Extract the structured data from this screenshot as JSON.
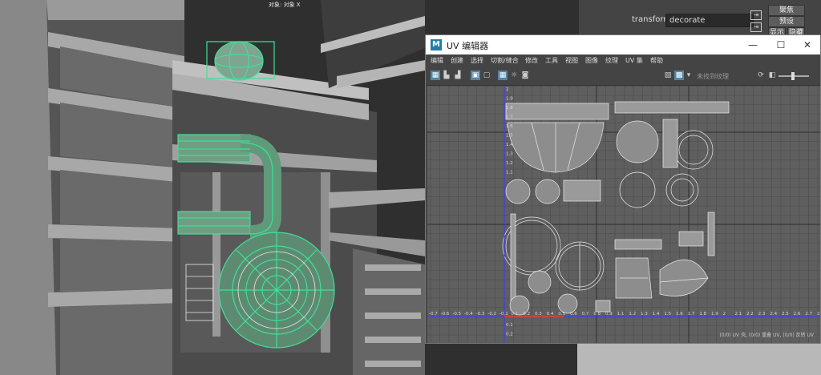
{
  "viewport": {
    "label": "对象: 对象 X"
  },
  "attribute_editor": {
    "transform_label": "transform:",
    "transform_value": "decorate",
    "focus_button": "聚焦",
    "presets_button": "预设",
    "show_button": "显示",
    "hide_button": "隐藏"
  },
  "uv_editor": {
    "logo_letter": "M",
    "title": "UV 编辑器",
    "window_controls": {
      "minimize": "—",
      "maximize": "☐",
      "close": "✕"
    },
    "menu": [
      "编辑",
      "创建",
      "选择",
      "切割/缝合",
      "修改",
      "工具",
      "视图",
      "图像",
      "纹理",
      "UV 集",
      "帮助"
    ],
    "texture_filter": "未找到纹理",
    "status": "(0/0) UV 壳, (0/0) 重叠 UV, (0/0) 反转 UV",
    "axis_ticks": [
      "-0.7",
      "-0.6",
      "-0.5",
      "-0.4",
      "-0.3",
      "-0.2",
      "-0.1",
      "0.1",
      "0.2",
      "0.3",
      "0.4",
      "0.5",
      "0.6",
      "0.7",
      "0.8",
      "0.9",
      "1.1",
      "1.2",
      "1.3",
      "1.4",
      "1.5",
      "1.6",
      "1.7",
      "1.8",
      "1.9",
      "2",
      "2.1",
      "2.2",
      "2.3",
      "2.4",
      "2.5",
      "2.6",
      "2.7",
      "2.8"
    ],
    "y_ticks": [
      "2",
      "1.9",
      "1.8",
      "1.7",
      "1.6",
      "1.5",
      "1.4",
      "1.3",
      "1.2",
      "1.1",
      "0.1",
      "0.2"
    ]
  },
  "colors": {
    "selection_green": "#3fe09a",
    "axis_blue": "#3a3aff",
    "axis_red": "#ff3a3a",
    "active_tool": "#5285a6"
  }
}
